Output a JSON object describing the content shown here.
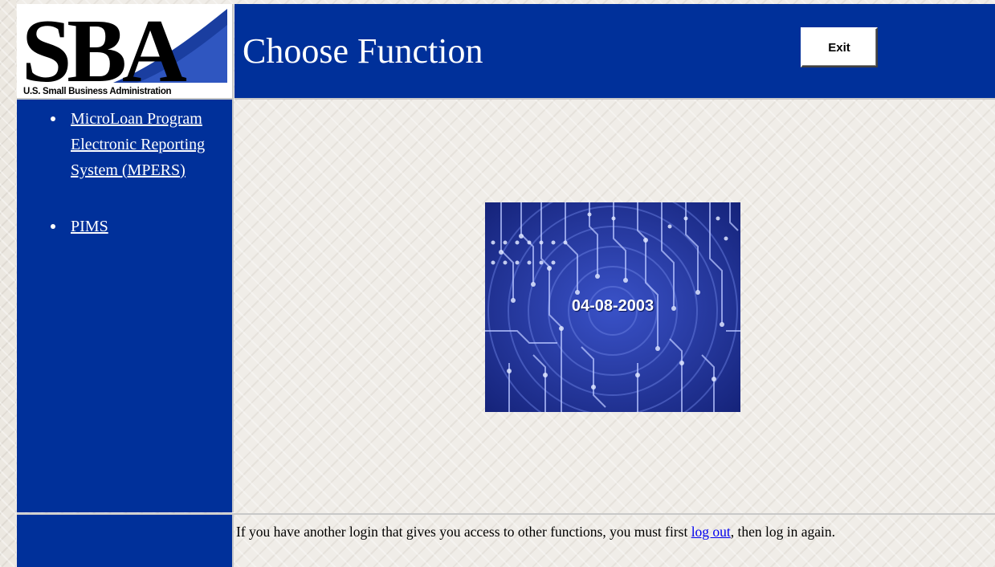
{
  "logo": {
    "wordmark": "SBA",
    "caption": "U.S. Small Business Administration"
  },
  "header": {
    "title": "Choose Function",
    "exit_label": "Exit"
  },
  "sidebar": {
    "items": [
      {
        "label": "MicroLoan Program Electronic Reporting System (MPERS)"
      },
      {
        "label": "PIMS"
      }
    ]
  },
  "banner": {
    "date": "04-08-2003"
  },
  "footer": {
    "text_before": "If you have another login that gives you access to other functions, you must first ",
    "link_label": "log out",
    "text_after": ", then log in again."
  },
  "colors": {
    "header_blue": "#00309a",
    "link_blue": "#0000ee",
    "background": "#f0ede8"
  },
  "icons": {
    "bullet": "bullet-icon"
  }
}
